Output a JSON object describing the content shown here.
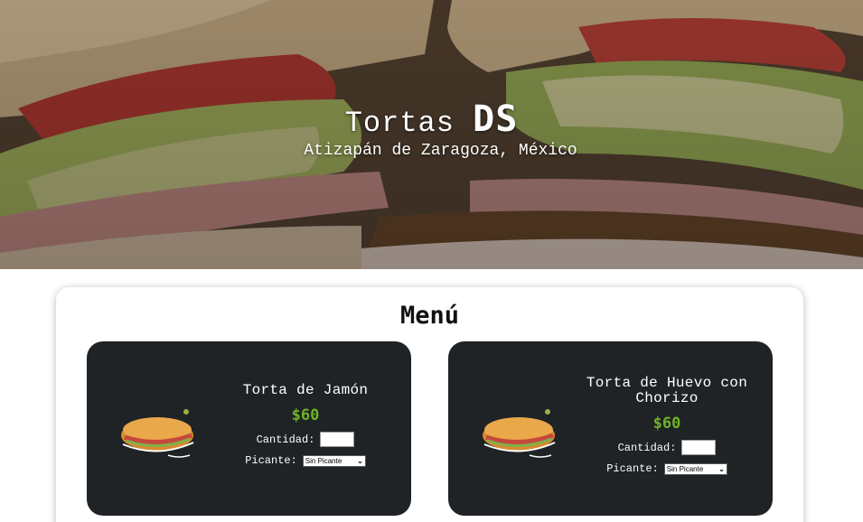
{
  "hero": {
    "title_light": "Tortas",
    "title_bold": "DS",
    "subtitle": "Atizapán de Zaragoza, México"
  },
  "menu": {
    "title": "Menú",
    "items": [
      {
        "name": "Torta de Jamón",
        "price": "$60",
        "quantity_label": "Cantidad:",
        "quantity_value": "",
        "spicy_label": "Picante:",
        "spicy_selected": "Sin Picante"
      },
      {
        "name": "Torta de Huevo con Chorizo",
        "price": "$60",
        "quantity_label": "Cantidad:",
        "quantity_value": "",
        "spicy_label": "Picante:",
        "spicy_selected": "Sin Picante"
      }
    ]
  },
  "colors": {
    "card_bg": "#1f2326",
    "price_green": "#6fb324"
  }
}
